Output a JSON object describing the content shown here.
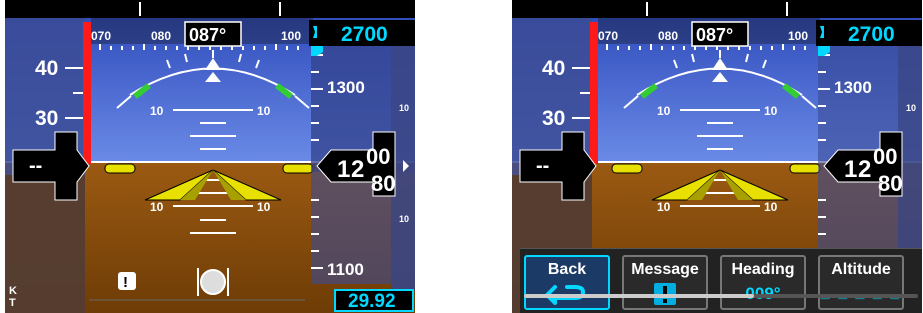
{
  "heading_tape": {
    "labels": [
      "070",
      "080",
      "100"
    ],
    "current": "087°"
  },
  "airspeed_tape": {
    "labels": [
      "40",
      "30"
    ],
    "current": "--",
    "unit_top": "K",
    "unit_bottom": "T"
  },
  "altitude": {
    "selected": "2700",
    "labels": [
      "1300",
      "1100"
    ],
    "current_prefix": "1",
    "current_hundreds": "2",
    "current_tens_top": "00",
    "current_tens_bottom": "80",
    "baro_setting": "29.92"
  },
  "attitude": {
    "pitch_labels": [
      "10",
      "10",
      "10",
      "10"
    ]
  },
  "vsi": {
    "labels": [
      "10",
      "10"
    ]
  },
  "status_icons": {
    "message": "!"
  },
  "softkeys": [
    {
      "label": "Back",
      "value": "",
      "selected": true
    },
    {
      "label": "Message",
      "value": "",
      "selected": false
    },
    {
      "label": "Heading",
      "value": "009°",
      "selected": false
    },
    {
      "label": "Altitude",
      "value": "_ _ _ _ _",
      "selected": false
    }
  ],
  "colors": {
    "sky": "#3f62cc",
    "ground": "#8b4f0e",
    "cyan": "#00d8ff",
    "red_band": "#ff1a1a",
    "yellow": "#e8e000",
    "green": "#33cc33"
  }
}
